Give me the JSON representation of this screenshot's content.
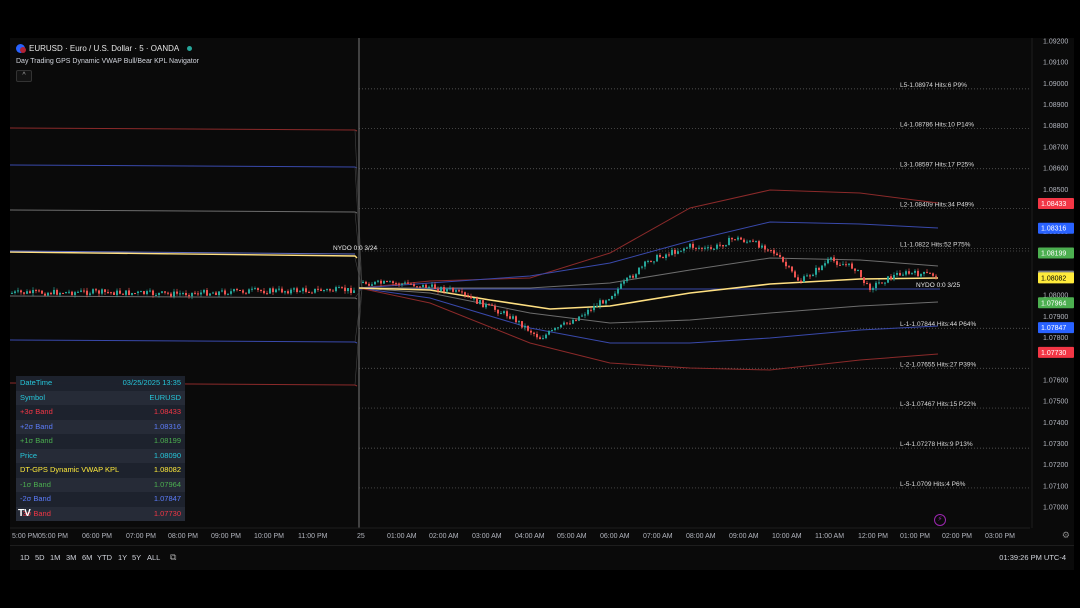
{
  "header": {
    "symbol_title": "EURUSD · Euro / U.S. Dollar · 5 · OANDA",
    "indicator_title": "Day Trading GPS Dynamic VWAP Bull/Bear KPL Navigator",
    "collapse_icon": "chevron-up-icon"
  },
  "price_axis": {
    "ticks": [
      "1.09200",
      "1.09100",
      "1.09000",
      "1.08900",
      "1.08800",
      "1.08700",
      "1.08600",
      "1.08500",
      "1.08300",
      "1.08200",
      "1.08100",
      "1.08000",
      "1.07900",
      "1.07800",
      "1.07600",
      "1.07500",
      "1.07400",
      "1.07300",
      "1.07200",
      "1.07100",
      "1.07000"
    ],
    "tick_values": [
      1.092,
      1.091,
      1.09,
      1.089,
      1.088,
      1.087,
      1.086,
      1.085,
      1.083,
      1.082,
      1.081,
      1.08,
      1.079,
      1.078,
      1.076,
      1.075,
      1.074,
      1.073,
      1.072,
      1.071,
      1.07
    ],
    "badges": [
      {
        "label": "1.08433",
        "value": 1.08433,
        "color": "#f23645"
      },
      {
        "label": "1.08316",
        "value": 1.08316,
        "color": "#2962ff"
      },
      {
        "label": "1.08199",
        "value": 1.08199,
        "color": "#4caf50"
      },
      {
        "label": "1.08090",
        "value": 1.0809,
        "color": "#787b86"
      },
      {
        "label": "1.08082",
        "value": 1.08082,
        "color": "#ffeb3b",
        "text_color": "#000000"
      },
      {
        "label": "1.07964",
        "value": 1.07964,
        "color": "#4caf50"
      },
      {
        "label": "1.07847",
        "value": 1.07847,
        "color": "#2962ff"
      },
      {
        "label": "1.07730",
        "value": 1.0773,
        "color": "#f23645"
      }
    ]
  },
  "time_axis": {
    "labels": [
      "5:00 PM",
      "05:00 PM",
      "06:00 PM",
      "07:00 PM",
      "08:00 PM",
      "09:00 PM",
      "10:00 PM",
      "11:00 PM",
      "25",
      "01:00 AM",
      "02:00 AM",
      "03:00 AM",
      "04:00 AM",
      "05:00 AM",
      "06:00 AM",
      "07:00 AM",
      "08:00 AM",
      "09:00 AM",
      "10:00 AM",
      "11:00 AM",
      "12:00 PM",
      "01:00 PM",
      "02:00 PM",
      "03:00 PM"
    ]
  },
  "kpl_levels": [
    {
      "label": "L5-1.08974 Hits:6 P9%",
      "value": 1.08974
    },
    {
      "label": "L4-1.08786 Hits:10 P14%",
      "value": 1.08786
    },
    {
      "label": "L3-1.08597 Hits:17 P25%",
      "value": 1.08597
    },
    {
      "label": "L2-1.08409 Hits:34 P49%",
      "value": 1.08409
    },
    {
      "label": "L1-1.0822 Hits:52 P75%",
      "value": 1.0822
    },
    {
      "label": "L-1-1.07844 Hits:44 P64%",
      "value": 1.07844
    },
    {
      "label": "L-2-1.07655 Hits:27 P39%",
      "value": 1.07655
    },
    {
      "label": "L-3-1.07467 Hits:15 P22%",
      "value": 1.07467
    },
    {
      "label": "L-4-1.07278 Hits:9 P13%",
      "value": 1.07278
    },
    {
      "label": "L-5-1.0709 Hits:4 P6%",
      "value": 1.0709
    }
  ],
  "nydo_labels": [
    {
      "label": "NYDO 0:0 3/24"
    },
    {
      "label": "NYDO 0:0 3/25"
    }
  ],
  "info_panel": {
    "rows": [
      {
        "label": "DateTime",
        "value": "03/25/2025 13:35",
        "color": "#26c6da"
      },
      {
        "label": "Symbol",
        "value": "EURUSD",
        "color": "#26c6da"
      },
      {
        "label": "+3σ Band",
        "value": "1.08433",
        "color": "#f23645"
      },
      {
        "label": "+2σ Band",
        "value": "1.08316",
        "color": "#5c7cfa"
      },
      {
        "label": "+1σ Band",
        "value": "1.08199",
        "color": "#4caf50"
      },
      {
        "label": "Price",
        "value": "1.08090",
        "color": "#26c6da"
      },
      {
        "label": "DT-GPS Dynamic VWAP KPL",
        "value": "1.08082",
        "color": "#ffeb3b"
      },
      {
        "label": "-1σ Band",
        "value": "1.07964",
        "color": "#4caf50"
      },
      {
        "label": "-2σ Band",
        "value": "1.07847",
        "color": "#5c7cfa"
      },
      {
        "label": "-3σ Band",
        "value": "1.07730",
        "color": "#f23645"
      }
    ],
    "logo_text": "TV"
  },
  "toolbar": {
    "ranges": [
      "1D",
      "5D",
      "1M",
      "3M",
      "6M",
      "YTD",
      "1Y",
      "5Y",
      "ALL"
    ],
    "calendar_icon": "calendar-range-icon",
    "clock": "01:39:26 PM UTC-4"
  },
  "colors": {
    "up": "#26a69a",
    "down": "#ef5350",
    "vwap": "#ffe082",
    "band1": "#6d6d6d",
    "band2": "#3949ab",
    "band3": "#8b2a2a"
  }
}
